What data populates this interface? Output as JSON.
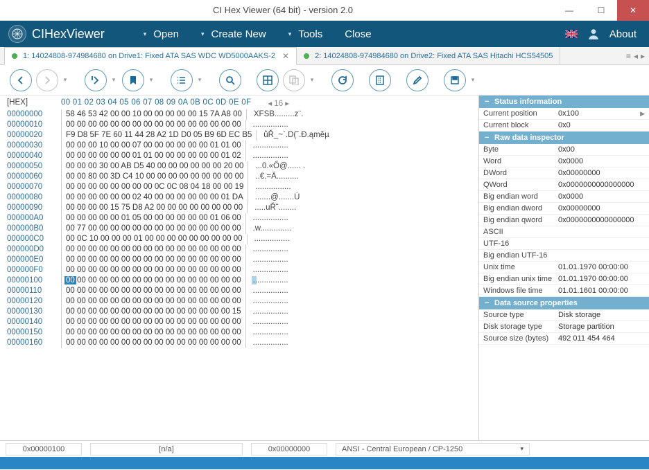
{
  "window_title": "CI Hex Viewer (64 bit) - version 2.0",
  "app_name": "CIHexViewer",
  "menu": {
    "open": "Open",
    "create": "Create New",
    "tools": "Tools",
    "close": "Close",
    "about": "About"
  },
  "tabs": [
    {
      "label": "1: 14024808-974984680 on Drive1: Fixed ATA SAS WDC WD5000AAKS-2",
      "active": true
    },
    {
      "label": "2: 14024808-974984680 on Drive2: Fixed ATA SAS Hitachi HCS54505",
      "active": false
    }
  ],
  "hex_header_label": "[HEX]",
  "hex_cols": "00 01 02 03 04 05 06 07 08 09 0A 0B 0C 0D 0E 0F",
  "row_nav": "◂ 16 ▸",
  "rows": [
    {
      "a": "00000000",
      "h": "58 46 53 42 00 00 10 00 00 00 00 00 15 7A A8 00",
      "t": "XFSB.........z¨."
    },
    {
      "a": "00000010",
      "h": "00 00 00 00 00 00 00 00 00 00 00 00 00 00 00 00",
      "t": "................"
    },
    {
      "a": "00000020",
      "h": "F9 D8 5F 7E 60 11 44 28 A2 1D D0 05 B9 6D EC B5",
      "t": "ůŘ_~`.D(˘.Đ.ąměµ"
    },
    {
      "a": "00000030",
      "h": "00 00 00 10 00 00 07 00 00 00 00 00 00 01 01 00",
      "t": "................"
    },
    {
      "a": "00000040",
      "h": "00 00 00 00 00 00 01 01 00 00 00 00 00 00 01 02",
      "t": "................"
    },
    {
      "a": "00000050",
      "h": "00 00 00 30 00 AB D5 40 00 00 00 00 00 00 20 00",
      "t": "...0.«Ő@...... ."
    },
    {
      "a": "00000060",
      "h": "00 00 80 00 3D C4 10 00 00 00 00 00 00 00 00 00",
      "t": "..€.=Ä.........."
    },
    {
      "a": "00000070",
      "h": "00 00 00 00 00 00 00 00 0C 0C 08 04 18 00 00 19",
      "t": "................"
    },
    {
      "a": "00000080",
      "h": "00 00 00 00 00 00 02 40 00 00 00 00 00 00 01 DA",
      "t": ".......@.......Ú"
    },
    {
      "a": "00000090",
      "h": "00 00 00 00 15 75 D8 A2 00 00 00 00 00 00 00 00",
      "t": ".....uŘ˘........"
    },
    {
      "a": "000000A0",
      "h": "00 00 00 00 00 01 05 00 00 00 00 00 00 01 06 00",
      "t": "................"
    },
    {
      "a": "000000B0",
      "h": "00 77 00 00 00 00 00 00 00 00 00 00 00 00 00 00",
      "t": ".w.............."
    },
    {
      "a": "000000C0",
      "h": "00 0C 10 00 00 00 01 00 00 00 00 00 00 00 00 00",
      "t": "................"
    },
    {
      "a": "000000D0",
      "h": "00 00 00 00 00 00 00 00 00 00 00 00 00 00 00 00",
      "t": "................"
    },
    {
      "a": "000000E0",
      "h": "00 00 00 00 00 00 00 00 00 00 00 00 00 00 00 00",
      "t": "................"
    },
    {
      "a": "000000F0",
      "h": "00 00 00 00 00 00 00 00 00 00 00 00 00 00 00 00",
      "t": "................"
    },
    {
      "a": "00000100",
      "h": "00 00 00 00 00 00 00 00 00 00 00 00 00 00 00 00",
      "t": "................",
      "sel": true
    },
    {
      "a": "00000110",
      "h": "00 00 00 00 00 00 00 00 00 00 00 00 00 00 00 00",
      "t": "................"
    },
    {
      "a": "00000120",
      "h": "00 00 00 00 00 00 00 00 00 00 00 00 00 00 00 00",
      "t": "................"
    },
    {
      "a": "00000130",
      "h": "00 00 00 00 00 00 00 00 00 00 00 00 00 00 00 15",
      "t": "................"
    },
    {
      "a": "00000140",
      "h": "00 00 00 00 00 00 00 00 00 00 00 00 00 00 00 00",
      "t": "................"
    },
    {
      "a": "00000150",
      "h": "00 00 00 00 00 00 00 00 00 00 00 00 00 00 00 00",
      "t": "................"
    },
    {
      "a": "00000160",
      "h": "00 00 00 00 00 00 00 00 00 00 00 00 00 00 00 00",
      "t": "................"
    }
  ],
  "side": {
    "sec1": "Status information",
    "sec2": "Raw data inspector",
    "sec3": "Data source properties",
    "status": [
      {
        "k": "Current position",
        "v": "0x100",
        "arrow": true
      },
      {
        "k": "Current block",
        "v": "0x0"
      }
    ],
    "insp": [
      {
        "k": "Byte",
        "v": "0x00"
      },
      {
        "k": "Word",
        "v": "0x0000"
      },
      {
        "k": "DWord",
        "v": "0x00000000"
      },
      {
        "k": "QWord",
        "v": "0x0000000000000000"
      },
      {
        "k": "Big endian word",
        "v": "0x0000"
      },
      {
        "k": "Big endian dword",
        "v": "0x00000000"
      },
      {
        "k": "Big endian qword",
        "v": "0x0000000000000000"
      },
      {
        "k": "ASCII",
        "v": ""
      },
      {
        "k": "UTF-16",
        "v": ""
      },
      {
        "k": "Big endian UTF-16",
        "v": ""
      },
      {
        "k": "Unix time",
        "v": "01.01.1970 00:00:00"
      },
      {
        "k": "Big endian unix time",
        "v": "01.01.1970 00:00:00"
      },
      {
        "k": "Windows file time",
        "v": "01.01.1601 00:00:00"
      }
    ],
    "props": [
      {
        "k": "Source type",
        "v": "Disk storage"
      },
      {
        "k": "Disk storage type",
        "v": "Storage partition"
      },
      {
        "k": "Source size (bytes)",
        "v": "492 011 454 464"
      }
    ]
  },
  "status": {
    "pos": "0x00000100",
    "sel": "[n/a]",
    "off": "0x00000000",
    "enc": "ANSI - Central European / CP-1250"
  }
}
